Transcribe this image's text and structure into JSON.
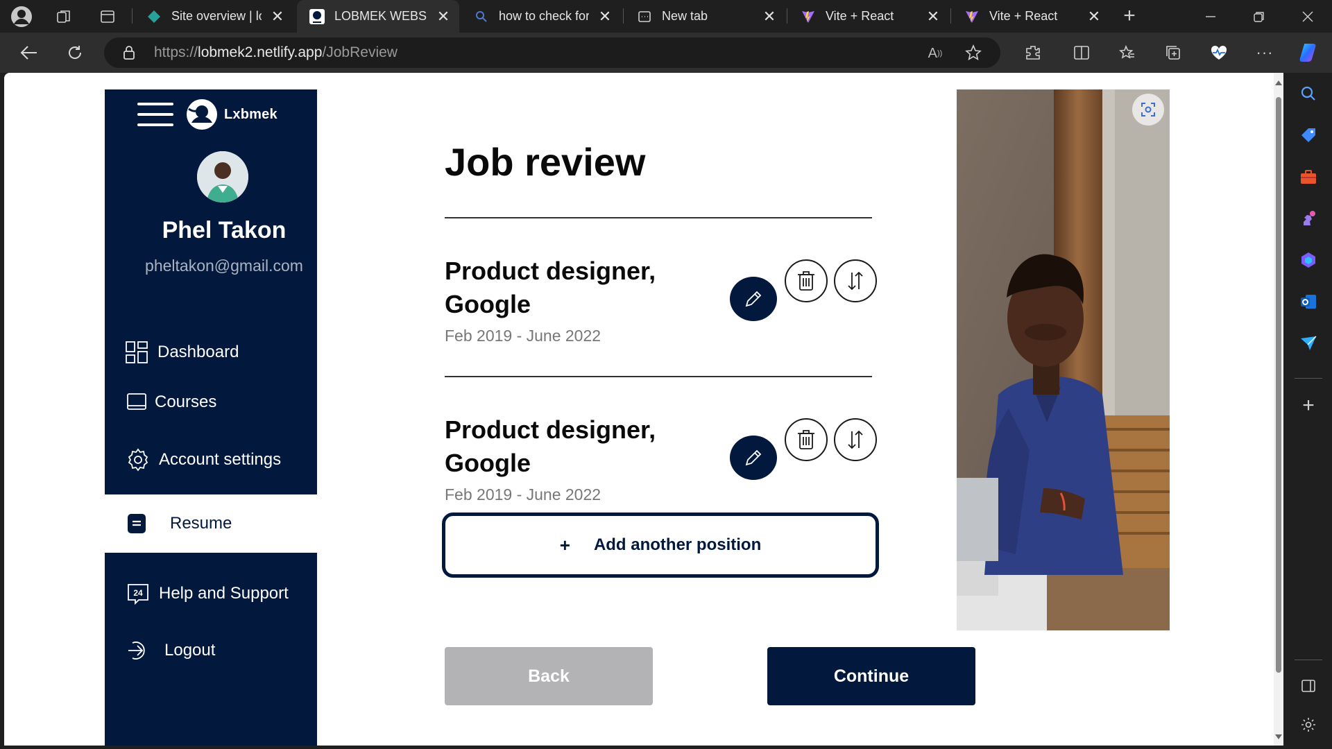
{
  "browser": {
    "tabs": [
      {
        "label": "Site overview | lo",
        "favicon": "netlify-icon",
        "active": false
      },
      {
        "label": "LOBMEK WEBSITE",
        "favicon": "lobmek-icon",
        "active": true
      },
      {
        "label": "how to check for",
        "favicon": "search-icon",
        "active": false
      },
      {
        "label": "New tab",
        "favicon": "newtab-icon",
        "active": false
      },
      {
        "label": "Vite + React",
        "favicon": "vite-icon",
        "active": false
      },
      {
        "label": "Vite + React",
        "favicon": "vite-icon",
        "active": false
      }
    ],
    "url_scheme": "https://",
    "url_host": "lobmek2.netlify.app",
    "url_path": "/JobReview"
  },
  "sidebar": {
    "logo_text": "Lxbmek",
    "user_name": "Phel Takon",
    "user_email": "pheltakon@gmail.com",
    "nav": [
      {
        "label": "Dashboard",
        "icon": "dashboard-icon"
      },
      {
        "label": "Courses",
        "icon": "courses-icon"
      },
      {
        "label": "Account settings",
        "icon": "gear-icon"
      },
      {
        "label": "Resume",
        "icon": "resume-icon",
        "active": true
      },
      {
        "label": "Help and Support",
        "icon": "support-24-icon"
      },
      {
        "label": "Logout",
        "icon": "logout-icon"
      }
    ]
  },
  "main": {
    "title": "Job review",
    "jobs": [
      {
        "title": "Product designer, Google",
        "dates": "Feb 2019 - June 2022"
      },
      {
        "title": "Product designer, Google",
        "dates": "Feb 2019 - June 2022"
      }
    ],
    "add_position_plus": "+",
    "add_position_label": "Add another position",
    "back_label": "Back",
    "continue_label": "Continue"
  },
  "colors": {
    "brand_navy": "#03183d",
    "back_gray": "#b3b3b5"
  }
}
